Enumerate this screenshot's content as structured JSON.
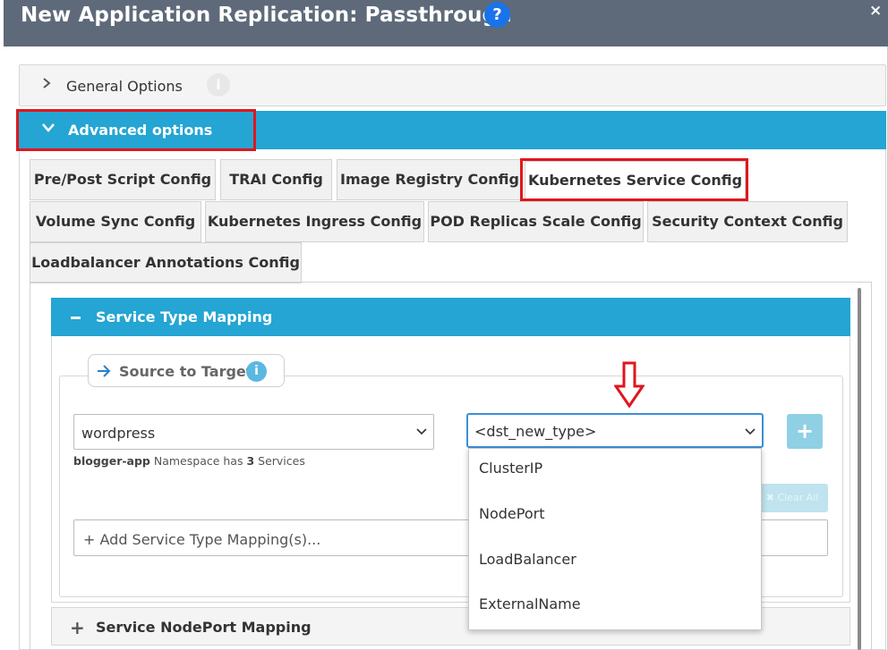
{
  "header": {
    "title": "New Application Replication: Passthrough",
    "help": "?",
    "close": "×"
  },
  "general_options": {
    "label": "General Options",
    "info": "i"
  },
  "advanced_options": {
    "label": "Advanced options"
  },
  "tabs": [
    {
      "label": "Pre/Post Script Config"
    },
    {
      "label": "TRAI Config"
    },
    {
      "label": "Image Registry Config"
    },
    {
      "label": "Kubernetes Service Config",
      "active": true
    },
    {
      "label": "Volume Sync Config"
    },
    {
      "label": "Kubernetes Ingress Config"
    },
    {
      "label": "POD Replicas Scale Config"
    },
    {
      "label": "Security Context Config"
    },
    {
      "label": "Loadbalancer Annotations Config"
    }
  ],
  "service_type_mapping": {
    "label": "Service Type Mapping",
    "source_to_target": {
      "label": "Source to Target",
      "info": "i"
    },
    "source_select": {
      "value": "wordpress"
    },
    "namespace_note": {
      "namespace": "blogger-app",
      "text1": " Namespace has ",
      "count": "3",
      "text2": " Services"
    },
    "target_select": {
      "value": "<dst_new_type>"
    },
    "target_options": [
      "ClusterIP",
      "NodePort",
      "LoadBalancer",
      "ExternalName"
    ],
    "add_button": "+",
    "clear_all": "✖ Clear All",
    "add_mapping_placeholder": "+ Add Service Type Mapping(s)..."
  },
  "service_nodeport_mapping": {
    "plus": "+",
    "label": "Service NodePort Mapping"
  },
  "colors": {
    "header_bg": "#5e6a79",
    "accent": "#24a5d3",
    "highlight": "#e0161e"
  }
}
